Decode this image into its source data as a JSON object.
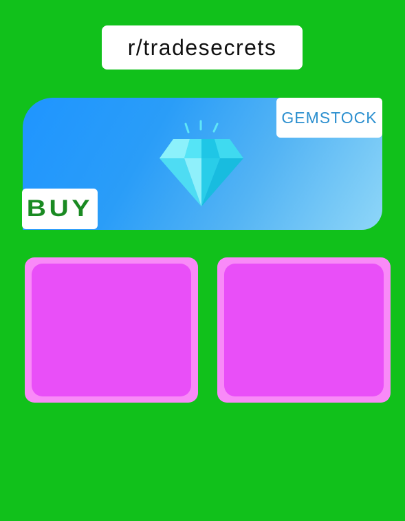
{
  "header": {
    "title": "r/tradesecrets"
  },
  "banner": {
    "icon": "diamond-icon",
    "gemstock_label": "GEMSTOCK",
    "buy_label": "BUY"
  },
  "cards": [
    {
      "name": "card-1"
    },
    {
      "name": "card-2"
    }
  ],
  "colors": {
    "background": "#11c11b",
    "banner_start": "#1f95ff",
    "banner_end": "#8ed6f8",
    "gemstock_text": "#2b8fcf",
    "buy_text": "#1a8a22",
    "card_outer": "#f98af8",
    "card_inner": "#e94ff8",
    "diamond": "#3ee0f5"
  }
}
